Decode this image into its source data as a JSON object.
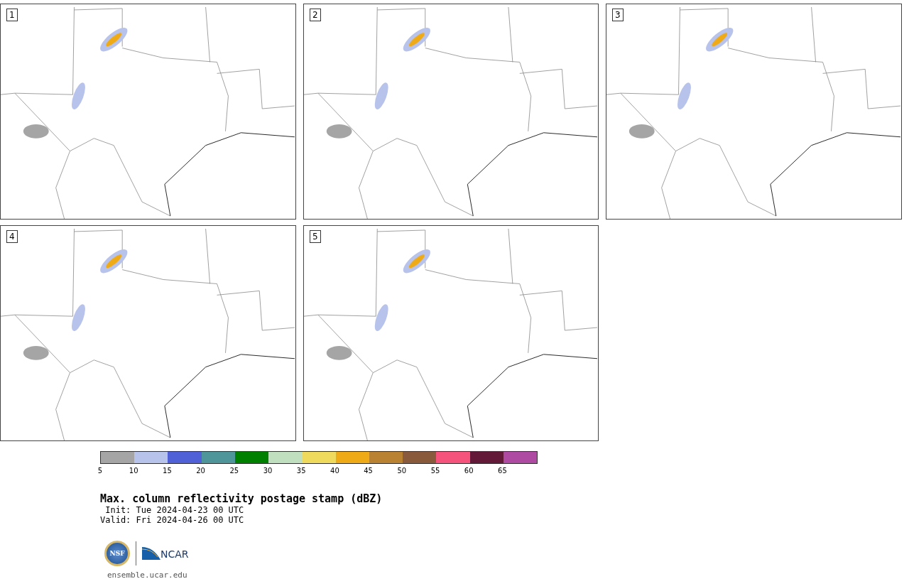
{
  "panels": [
    {
      "label": "1"
    },
    {
      "label": "2"
    },
    {
      "label": "3"
    },
    {
      "label": "4"
    },
    {
      "label": "5"
    }
  ],
  "colorbar": {
    "segments": [
      {
        "color": "#a5a5a5"
      },
      {
        "color": "#b8c3ec"
      },
      {
        "color": "#5060d6"
      },
      {
        "color": "#4f969b"
      },
      {
        "color": "#008000"
      },
      {
        "color": "#bfdfbf"
      },
      {
        "color": "#f0da5e"
      },
      {
        "color": "#efab17"
      },
      {
        "color": "#b98232"
      },
      {
        "color": "#8a5a3c"
      },
      {
        "color": "#f5527c"
      },
      {
        "color": "#621a38"
      },
      {
        "color": "#ae4aa2"
      }
    ],
    "ticks": [
      "5",
      "10",
      "15",
      "20",
      "25",
      "30",
      "35",
      "40",
      "45",
      "50",
      "55",
      "60",
      "65"
    ]
  },
  "title": "Max. column reflectivity postage stamp (dBZ)",
  "init": " Init: Tue 2024-04-23 00 UTC",
  "valid": "Valid: Fri 2024-04-26 00 UTC",
  "logos": {
    "nsf": "NSF",
    "ncar": "NCAR"
  },
  "footer": "ensemble.ucar.edu"
}
